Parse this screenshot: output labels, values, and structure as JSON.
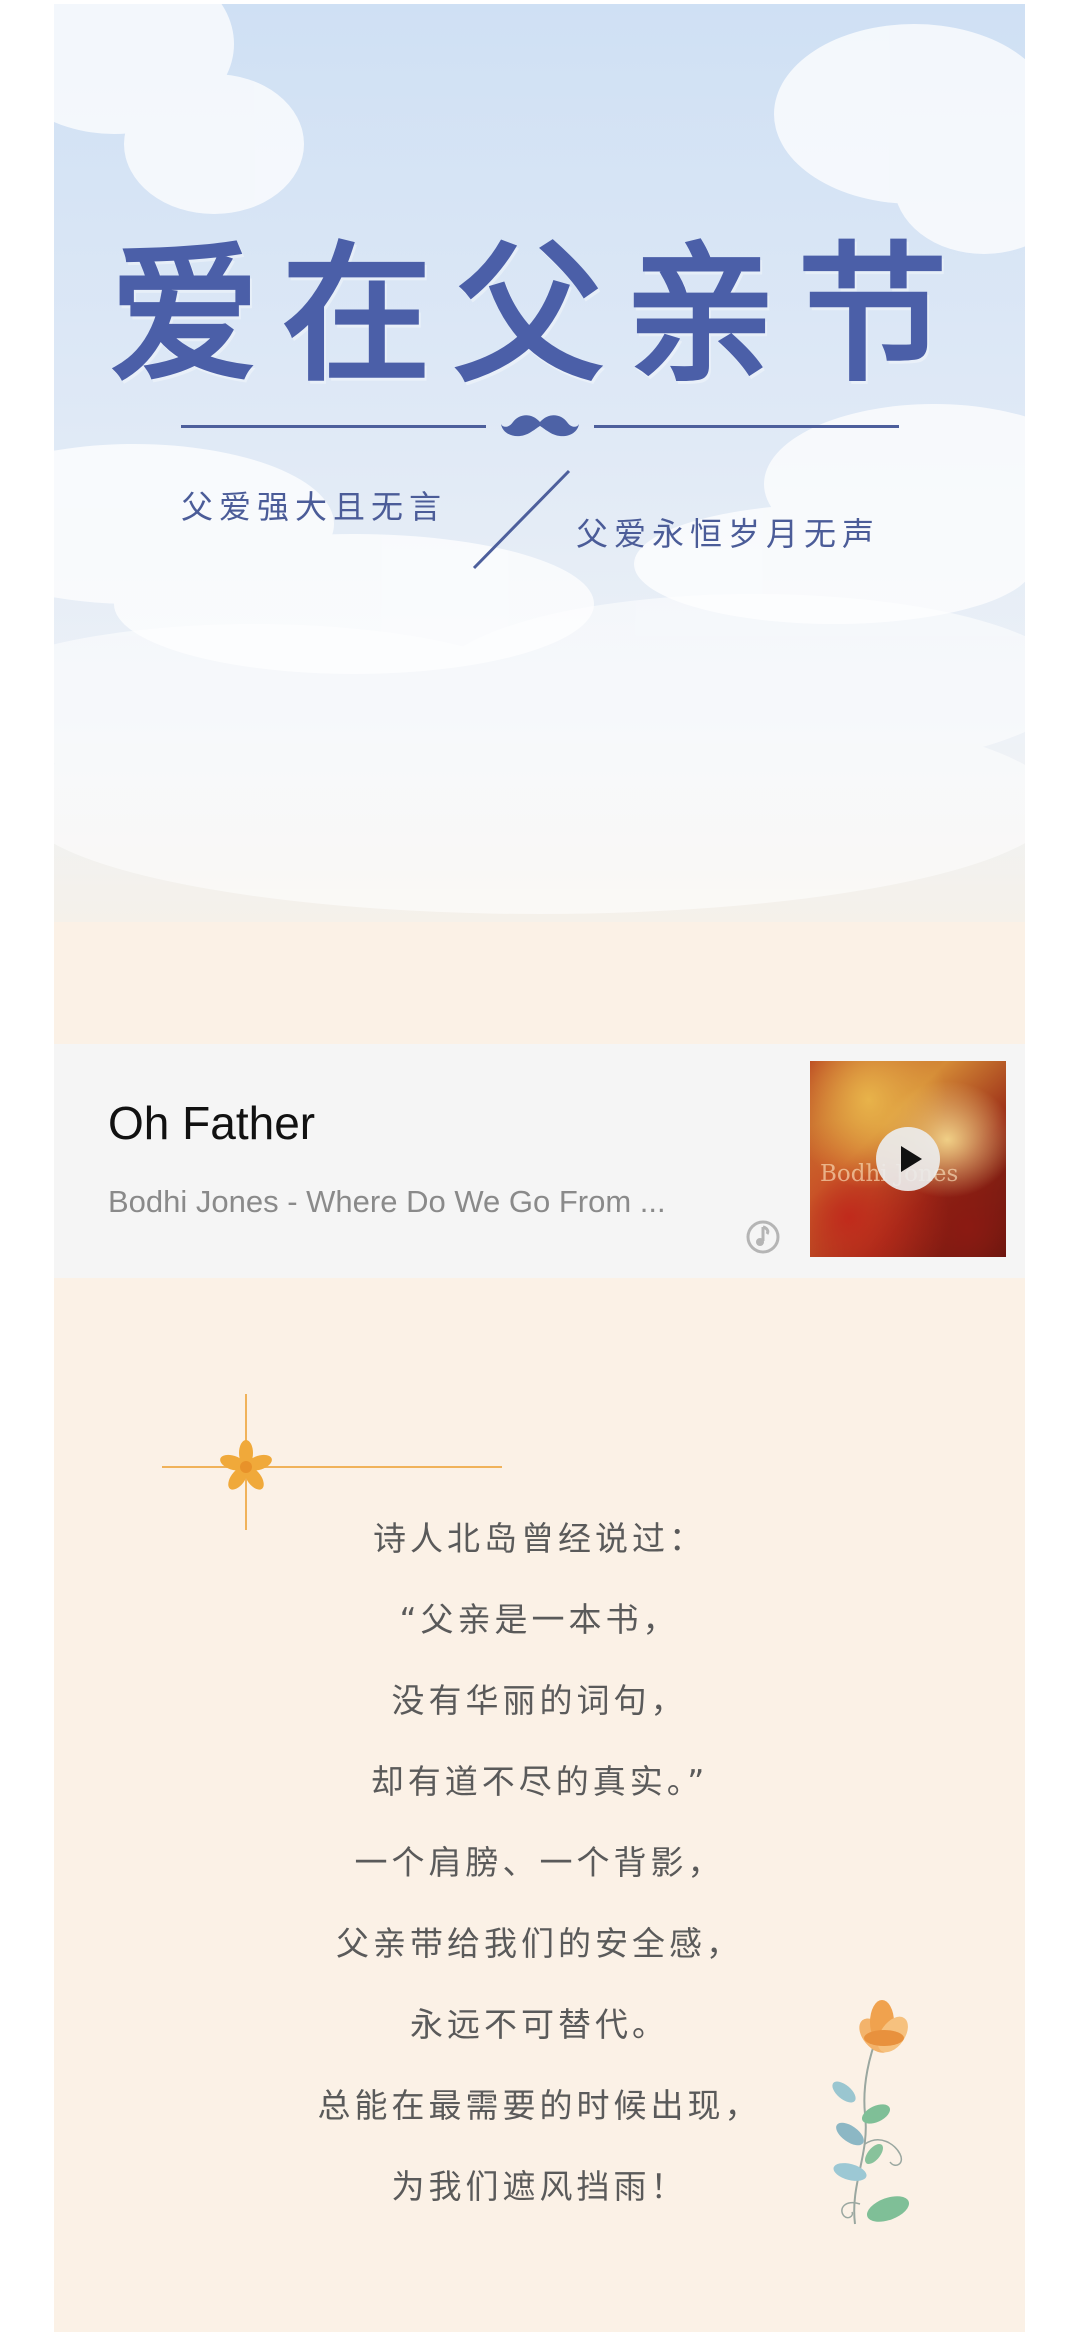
{
  "banner": {
    "title": "爱在父亲节",
    "tagline_left": "父爱强大且无言",
    "tagline_right": "父爱永恒岁月无声"
  },
  "music": {
    "title": "Oh Father",
    "subtitle": "Bodhi Jones - Where Do We Go From ...",
    "cover_text": "Bodhi Jones"
  },
  "poem": {
    "lines": [
      "诗人北岛曾经说过：",
      "“父亲是一本书，",
      "没有华丽的词句，",
      "却有道不尽的真实。”",
      "一个肩膀、一个背影，",
      "父亲带给我们的安全感，",
      "永远不可替代。",
      "总能在最需要的时候出现，",
      "为我们遮风挡雨！"
    ]
  },
  "colors": {
    "title_blue": "#4b5fa8",
    "page_bg": "#fbf1e6",
    "accent_orange": "#f0a93a"
  },
  "icons": {
    "mustache": "mustache-icon",
    "play": "play-icon",
    "music_logo": "music-note-icon",
    "star": "flower-star-icon",
    "flower": "flower-illustration"
  }
}
